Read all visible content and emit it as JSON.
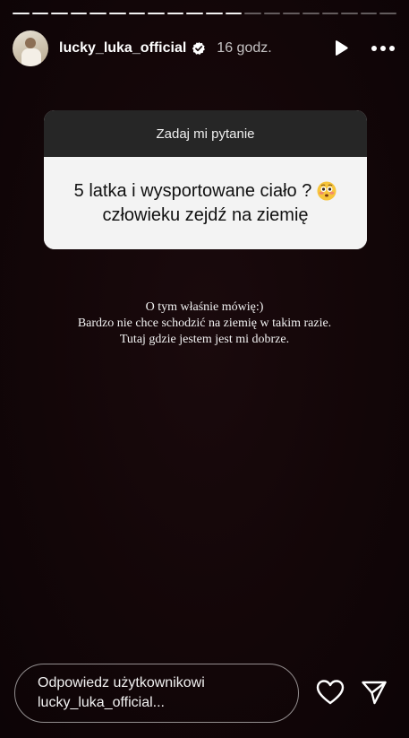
{
  "story": {
    "segments_total": 20,
    "segments_done": 12
  },
  "header": {
    "username": "lucky_luka_official",
    "verified": true,
    "time": "16 godz.",
    "icons": [
      "play-icon",
      "more-icon",
      "verified-badge-icon"
    ]
  },
  "sticker": {
    "title": "Zadaj mi pytanie",
    "question_line1": "5 latka i wysportowane ciało ?",
    "question_line2": "człowieku zejdź na ziemię",
    "emoji": "flushed-face-icon"
  },
  "caption": {
    "line1": "O tym właśnie mówię:)",
    "line2": "Bardzo nie chce schodzić na ziemię w takim razie.",
    "line3": "Tutaj gdzie jestem jest mi dobrze."
  },
  "footer": {
    "reply_line1": "Odpowiedz użytkownikowi",
    "reply_line2": "lucky_luka_official...",
    "icons": [
      "heart-icon",
      "send-icon"
    ]
  },
  "colors": {
    "background": "#130608",
    "sticker_header": "#262626",
    "sticker_body": "#f3f3f3",
    "verified": "#ffffff"
  }
}
